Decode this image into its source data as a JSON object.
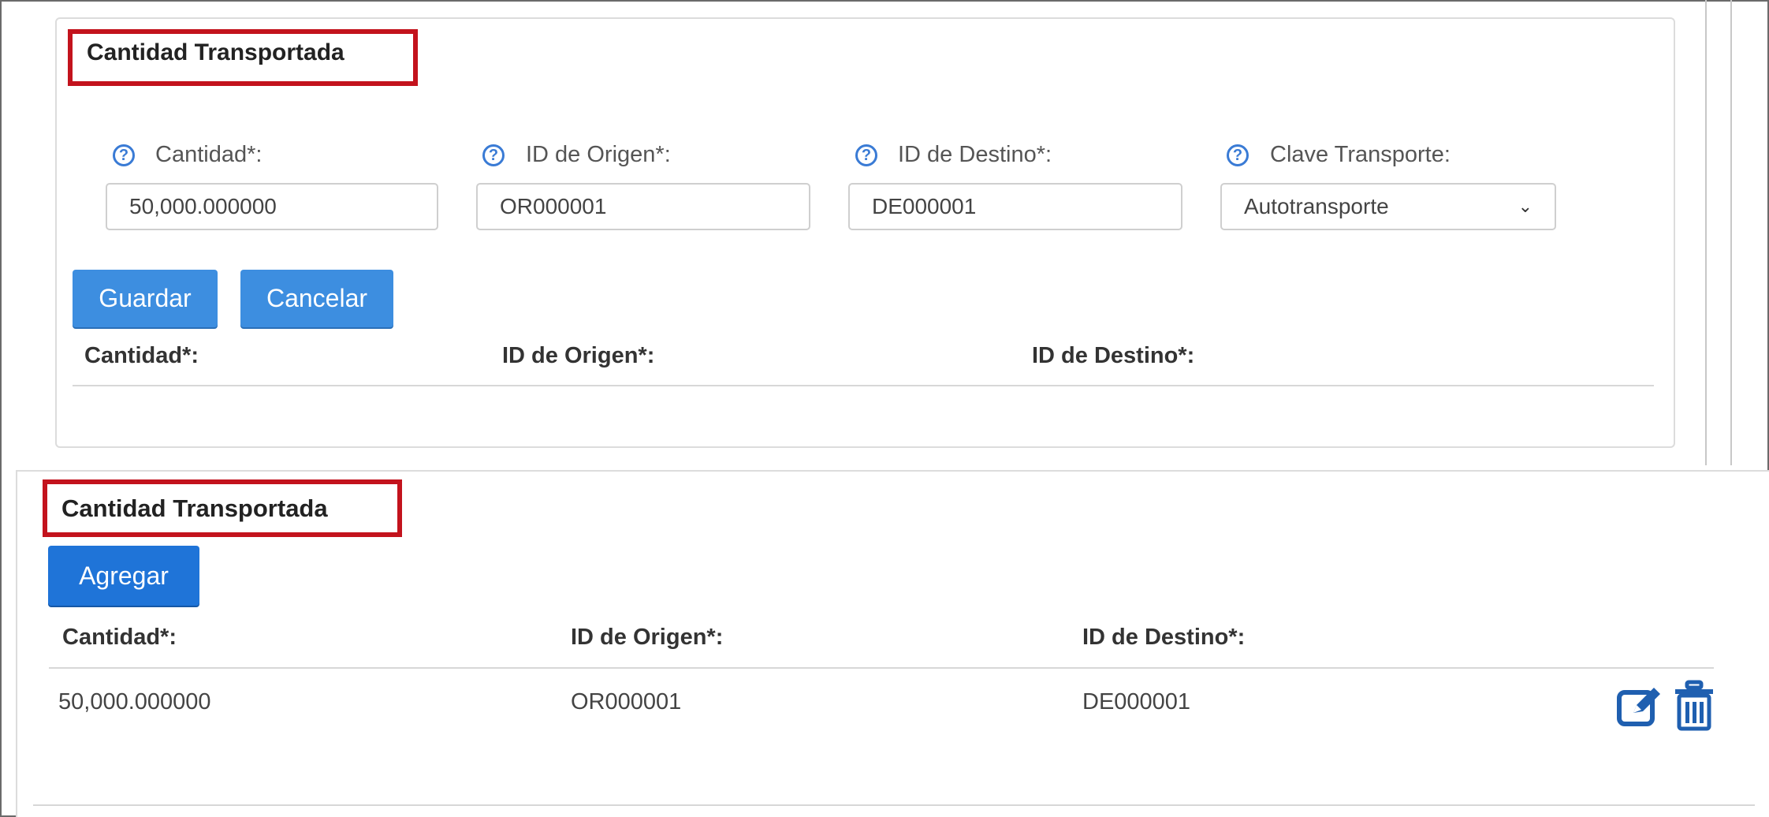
{
  "top_panel": {
    "title": "Cantidad Transportada",
    "fields": [
      {
        "label": "Cantidad*:",
        "value": "50,000.000000",
        "help_icon": "?"
      },
      {
        "label": "ID de Origen*:",
        "value": "OR000001",
        "help_icon": "?"
      },
      {
        "label": "ID de Destino*:",
        "value": "DE000001",
        "help_icon": "?"
      },
      {
        "label": "Clave Transporte:",
        "value": "Autotransporte",
        "help_icon": "?"
      }
    ],
    "buttons": {
      "save": "Guardar",
      "cancel": "Cancelar"
    },
    "table_headers": [
      "Cantidad*:",
      "ID de Origen*:",
      "ID de Destino*:"
    ]
  },
  "bottom_panel": {
    "title": "Cantidad Transportada",
    "add_button": "Agregar",
    "table_headers": [
      "Cantidad*:",
      "ID de Origen*:",
      "ID de Destino*:"
    ],
    "rows": [
      {
        "cantidad": "50,000.000000",
        "origen": "OR000001",
        "destino": "DE000001"
      }
    ]
  },
  "colors": {
    "accent": "#3d8ee0",
    "accent_dark": "#1f74d8",
    "highlight": "#c3131d",
    "icon": "#1f5fb0"
  },
  "icons": {
    "help": "question-circle-icon",
    "edit": "edit-icon",
    "delete": "trash-icon",
    "dropdown": "chevron-down-icon"
  }
}
